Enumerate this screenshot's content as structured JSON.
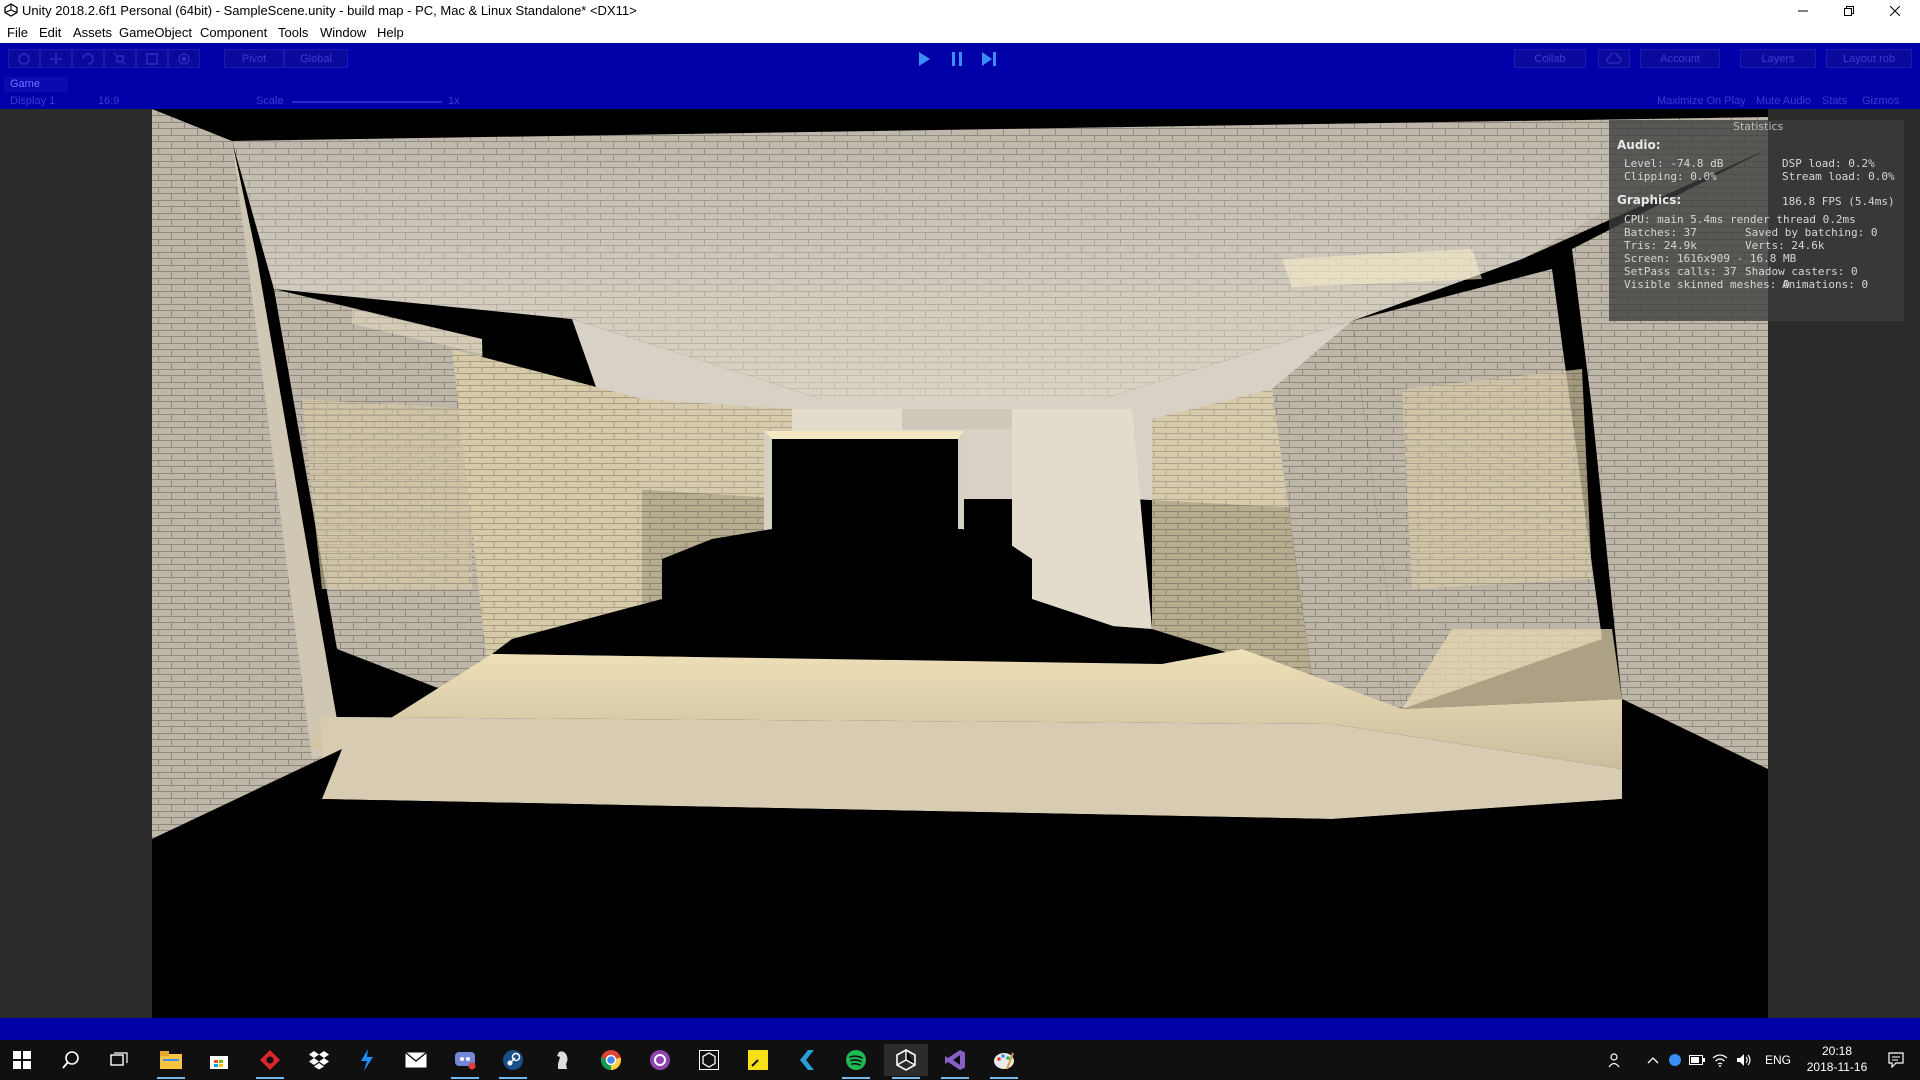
{
  "window": {
    "title": "Unity 2018.2.6f1 Personal (64bit) - SampleScene.unity - build map - PC, Mac & Linux Standalone* <DX11>"
  },
  "menu": {
    "items": [
      "File",
      "Edit",
      "Assets",
      "GameObject",
      "Component",
      "Tools",
      "Window",
      "Help"
    ]
  },
  "toolbar": {
    "pivot_label": "Pivot",
    "global_label": "Global",
    "collab_label": "Collab",
    "account_label": "Account",
    "layers_label": "Layers",
    "layout_label": "Layout rob"
  },
  "game_view": {
    "tab_label": "Game",
    "display_label": "Display 1",
    "aspect_label": "16:9",
    "scale_label": "Scale",
    "scale_value": "1x",
    "maximize_label": "Maximize On Play",
    "mute_label": "Mute Audio",
    "stats_label": "Stats",
    "gizmos_label": "Gizmos"
  },
  "stats": {
    "title": "Statistics",
    "audio_header": "Audio:",
    "level": "Level: -74.8 dB",
    "clipping": "Clipping: 0.0%",
    "dsp_load": "DSP load: 0.2%",
    "stream_load": "Stream load: 0.0%",
    "graphics_header": "Graphics:",
    "fps": "186.8 FPS (5.4ms)",
    "cpu": "CPU: main 5.4ms  render thread 0.2ms",
    "batches": "Batches: 37",
    "saved_batching": "Saved by batching: 0",
    "tris": "Tris: 24.9k",
    "verts": "Verts: 24.6k",
    "screen": "Screen: 1616x909 - 16.8 MB",
    "setpass": "SetPass calls: 37",
    "shadow_casters": "Shadow casters: 0",
    "skinned": "Visible skinned meshes: 0",
    "animations": "Animations: 0"
  },
  "taskbar": {
    "apps": [
      "start-icon",
      "search-icon",
      "task-view-icon",
      "file-explorer-icon",
      "store-icon",
      "app-red-icon",
      "dropbox-icon",
      "bolt-app-icon",
      "mail-icon",
      "discord-icon",
      "steam-icon",
      "chess-icon",
      "chrome-icon",
      "purple-app-icon",
      "unity-hub-icon",
      "sticky-notes-icon",
      "arrow-app-icon",
      "spotify-icon",
      "unity-icon",
      "visual-studio-icon",
      "paint-icon"
    ],
    "language": "ENG",
    "time": "20:18",
    "date": "2018-11-16"
  },
  "colors": {
    "toolbar_bg": "#0000a8",
    "play_accent": "#3a8df5",
    "taskbar_bg": "#101010"
  }
}
